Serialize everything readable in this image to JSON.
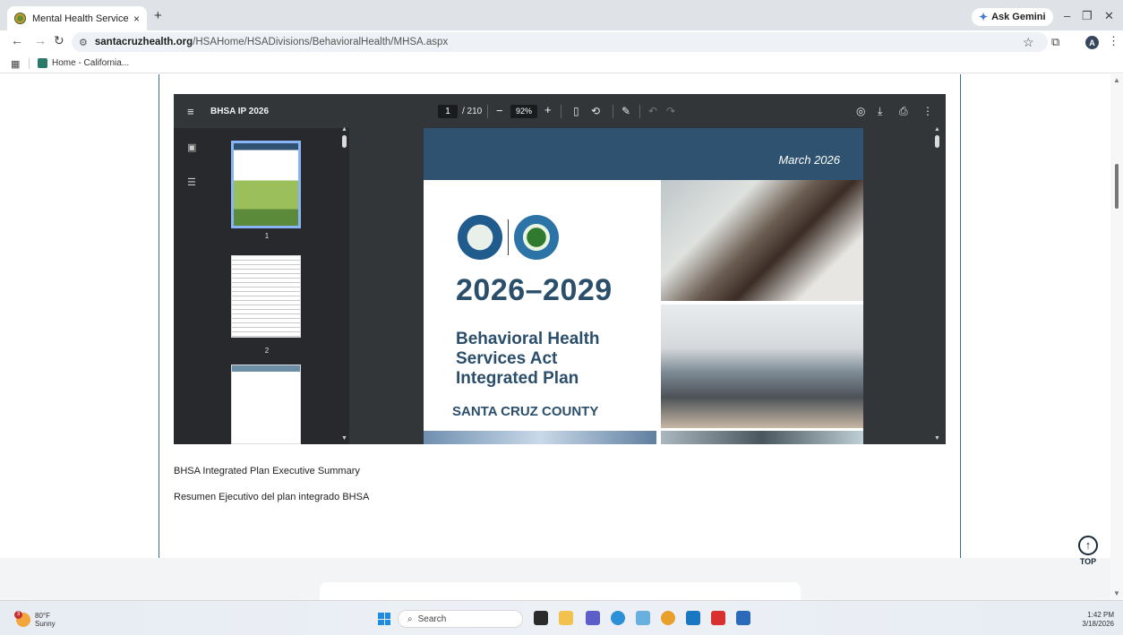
{
  "browser": {
    "tab_title": "Mental Health Services Act",
    "tab_close": "×",
    "new_tab": "+",
    "gemini_label": "Ask Gemini",
    "url_domain": "santacruzhealth.org",
    "url_path": "/HSAHome/HSADivisions/BehavioralHealth/MHSA.aspx",
    "avatar_letter": "A",
    "bookmark_label": "Home - California..."
  },
  "pdf_viewer": {
    "title": "BHSA IP 2026",
    "current_page": "1",
    "page_count": "/ 210",
    "zoom": "92%",
    "thumbnails": [
      "1",
      "2"
    ]
  },
  "pdf_page": {
    "date": "March 2026",
    "years": "2026–2029",
    "plan_lines": [
      "Behavioral Health",
      "Services Act",
      "Integrated Plan"
    ],
    "county": "SANTA CRUZ COUNTY"
  },
  "links": [
    "BHSA Integrated Plan Executive Summary",
    "Resumen Ejecutivo del plan integrado BHSA"
  ],
  "top_button": "TOP",
  "taskbar": {
    "weather_temp": "80°F",
    "weather_desc": "Sunny",
    "weather_badge": "3",
    "search_placeholder": "Search",
    "time": "1:42 PM",
    "date": "3/18/2026"
  },
  "colors": {
    "pdf_dark": "#323639",
    "brand_blue": "#2b4f6b",
    "card_border": "#3a6aa0"
  }
}
